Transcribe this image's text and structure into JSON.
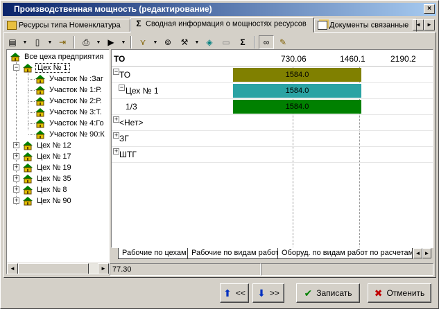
{
  "window": {
    "title": "Производственная мощность (редактирование)",
    "close_glyph": "×"
  },
  "tabs": [
    {
      "label": "Ресурсы типа Номенклатура",
      "icon": "resource-icon"
    },
    {
      "label": "Сводная информация о мощностях ресурсов",
      "icon": "sigma-icon"
    },
    {
      "label": "Документы связанные",
      "icon": "documents-icon"
    }
  ],
  "tab_arrows": {
    "left": "◄",
    "right": "►"
  },
  "toolbar": {
    "icons": [
      "table-icon",
      "document-icon",
      "exit-door-icon",
      "print-icon",
      "play-icon",
      "filter-icon",
      "binoculars-icon",
      "tools-icon",
      "info-icon",
      "blank-document-icon",
      "sigma-icon",
      "glasses-icon",
      "edit-note-icon"
    ],
    "glyphs": {
      "table": "▤",
      "document": "▯",
      "exit": "⇥",
      "print": "⎙",
      "play": "▶",
      "filter": "⋎",
      "binoculars": "⊚",
      "tools": "⚒",
      "info": "◈",
      "blank": "▭",
      "sigma": "Σ",
      "glasses": "∞",
      "edit": "✎",
      "dropdown": "▼"
    }
  },
  "tree": {
    "root": "Все цеха предприятия",
    "items": [
      {
        "label": "Цех № 1",
        "expanded": true,
        "selected": true
      },
      {
        "label": "Участок № :Заг",
        "child": true
      },
      {
        "label": "Участок № 1:Р.",
        "child": true
      },
      {
        "label": "Участок № 2:Р.",
        "child": true
      },
      {
        "label": "Участок № 3:Т.",
        "child": true
      },
      {
        "label": "Участок № 4:Го",
        "child": true
      },
      {
        "label": "Участок № 90:К",
        "child": true
      },
      {
        "label": "Цех № 12"
      },
      {
        "label": "Цех № 17"
      },
      {
        "label": "Цех № 19"
      },
      {
        "label": "Цех № 35"
      },
      {
        "label": "Цех № 8"
      },
      {
        "label": "Цех № 90"
      }
    ],
    "expand_glyph": "+",
    "collapse_glyph": "−"
  },
  "grid": {
    "header": "ТО",
    "ticks": [
      "730.06",
      "1460.1",
      "2190.2"
    ],
    "rows": [
      {
        "label": "ТО",
        "expander": "−",
        "level": 0
      },
      {
        "label": "Цех № 1",
        "expander": "−",
        "level": 1
      },
      {
        "label": "1/3",
        "level": 2
      },
      {
        "label": "<Нет>",
        "expander": "+",
        "level": 0
      },
      {
        "label": "ЗГ",
        "expander": "+",
        "level": 0
      },
      {
        "label": "ШТГ",
        "expander": "+",
        "level": 0
      }
    ],
    "bars": [
      {
        "row": 0,
        "value": "1584.0",
        "color": "#808000"
      },
      {
        "row": 1,
        "value": "1584.0",
        "color": "#2aa3a3"
      },
      {
        "row": 2,
        "value": "1584.0",
        "color": "#008000"
      }
    ]
  },
  "sheet_tabs": [
    "Рабочие по цехам",
    "Рабочие по видам работ",
    "Оборуд. по видам работ по расчетам"
  ],
  "status": {
    "value": "77.30"
  },
  "buttons": {
    "prev": "<<",
    "next": ">>",
    "prev_icon": "⬆",
    "next_icon": "⬇",
    "save": "Записать",
    "save_icon": "✔",
    "cancel": "Отменить",
    "cancel_icon": "✖"
  },
  "scroll_glyphs": {
    "left": "◄",
    "right": "►"
  }
}
